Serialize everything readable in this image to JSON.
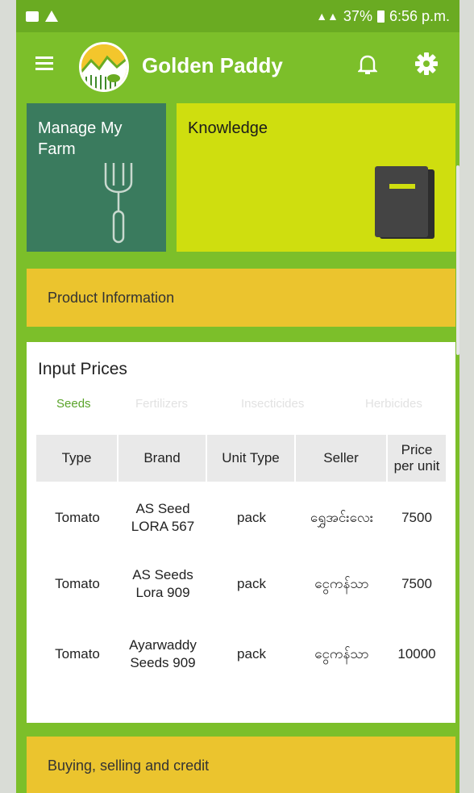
{
  "status_bar": {
    "battery": "37%",
    "time": "6:56 p.m."
  },
  "app_bar": {
    "title": "Golden Paddy"
  },
  "tiles": {
    "manage_farm": "Manage My Farm",
    "knowledge": "Knowledge"
  },
  "product_info": "Product Information",
  "input_prices": {
    "title": "Input Prices",
    "tabs": [
      "Seeds",
      "Fertilizers",
      "Insecticides",
      "Herbicides"
    ],
    "active_tab": "Seeds",
    "columns": [
      "Type",
      "Brand",
      "Unit Type",
      "Seller",
      "Price per unit"
    ],
    "rows": [
      [
        "Tomato",
        "AS Seed LORA 567",
        "pack",
        "ရွှေအင်းလေး",
        "7500"
      ],
      [
        "Tomato",
        "AS Seeds Lora 909",
        "pack",
        "ငွေကန်သာ",
        "7500"
      ],
      [
        "Tomato",
        "Ayarwaddy Seeds 909",
        "pack",
        "ငွေကန်သာ",
        "10000"
      ]
    ]
  },
  "buying_selling": "Buying, selling and credit",
  "colors": {
    "background_green": "#7cbf2a",
    "farm_tile": "#3a7b5e",
    "knowledge_tile": "#cfde0f",
    "yellow_card": "#ebc42e",
    "active_tab": "#5aa32a"
  },
  "icons": [
    "menu-icon",
    "logo-icon",
    "bell-icon",
    "gear-icon",
    "rake-icon",
    "book-icon"
  ]
}
